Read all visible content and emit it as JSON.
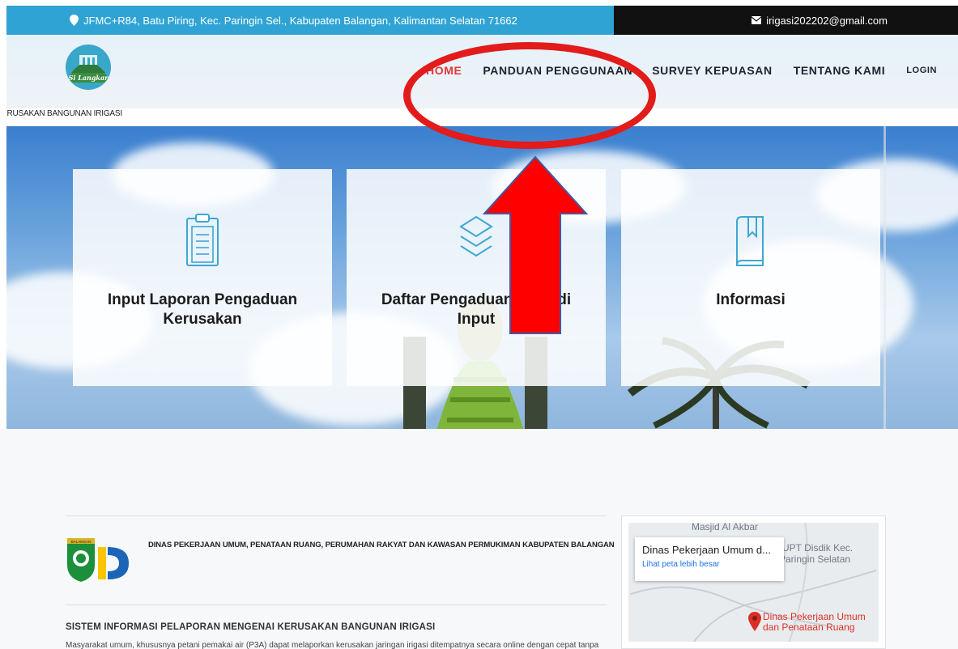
{
  "topbar": {
    "address": "JFMC+R84, Batu Piring, Kec. Paringin Sel., Kabupaten Balangan, Kalimantan Selatan 71662",
    "email": "irigasi202202@gmail.com",
    "address_bg": "#2fa4d4",
    "email_bg": "#111111"
  },
  "header": {
    "logo_text": "Si Langkar",
    "nav": {
      "home": "HOME",
      "panduan": "PANDUAN PENGGUNAAN",
      "survey": "SURVEY KEPUASAN",
      "tentang": "TENTANG KAMI",
      "login": "LOGIN"
    },
    "active_color": "#e53535"
  },
  "marquee": {
    "text": "ERUSAKAN BANGUNAN IRIGASI"
  },
  "cards": [
    {
      "title": "Input Laporan Pengaduan Kerusakan",
      "icon": "clipboard-icon"
    },
    {
      "title": "Daftar Pengaduan yang di Input",
      "icon": "layers-icon"
    },
    {
      "title": "Informasi",
      "icon": "book-icon"
    }
  ],
  "department": {
    "name": "DINAS PEKERJAAN UMUM, PENATAAN RUANG, PERUMAHAN RAKYAT DAN KAWASAN PERMUKIMAN KABUPATEN BALANGAN",
    "logo_text": "BALANGAN"
  },
  "system": {
    "title": "SISTEM INFORMASI PELAPORAN MENGENAI KERUSAKAN BANGUNAN IRIGASI",
    "description": "Masyarakat umum, khususnya petani pemakai air (P3A) dapat melaporkan kerusakan jaringan irigasi ditempatnya secara online dengan cepat tanpa"
  },
  "map": {
    "popup_title": "Dinas Pekerjaan Umum d...",
    "popup_link": "Lihat peta lebih besar",
    "label_masjid": "Masjid Al Akbar",
    "label_upt_1": "UPT Disdik Kec.",
    "label_upt_2": "Paringin Selatan",
    "pin_label_1": "Dinas Pekerjaan Umum",
    "pin_label_2": "dan Penataan Ruang"
  },
  "annotation_color": "#e21b1b"
}
